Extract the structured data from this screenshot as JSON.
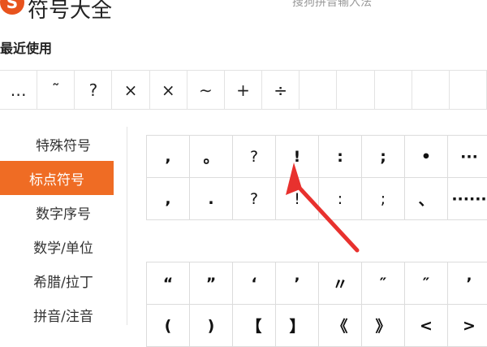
{
  "header": {
    "logo_letter": "S",
    "title": "符号大全",
    "subtitle": "搜狗拼音输入法"
  },
  "recent": {
    "label": "最近使用",
    "symbols": [
      "…",
      "˜",
      "?",
      "×",
      "×",
      "∼",
      "+",
      "÷",
      "",
      "",
      "",
      "",
      ""
    ]
  },
  "sidebar": {
    "items": [
      {
        "label": "特殊符号",
        "active": false
      },
      {
        "label": "标点符号",
        "active": true
      },
      {
        "label": "数字序号",
        "active": false
      },
      {
        "label": "数学/单位",
        "active": false
      },
      {
        "label": "希腊/拉丁",
        "active": false
      },
      {
        "label": "拼音/注音",
        "active": false
      }
    ]
  },
  "grid1": {
    "symbols": [
      ",",
      "。",
      "?",
      "!",
      ":",
      ";",
      "•",
      "···",
      ",",
      ".",
      "?",
      "!",
      ":",
      ";",
      "、",
      "······"
    ]
  },
  "grid2": {
    "symbols": [
      "“",
      "”",
      "‘",
      "’",
      "〃",
      "″",
      "″",
      "’",
      "(",
      ")",
      "【",
      "】",
      "《",
      "》",
      "<",
      ">"
    ]
  },
  "colors": {
    "accent": "#ef6c24",
    "arrow": "#e8312e"
  }
}
